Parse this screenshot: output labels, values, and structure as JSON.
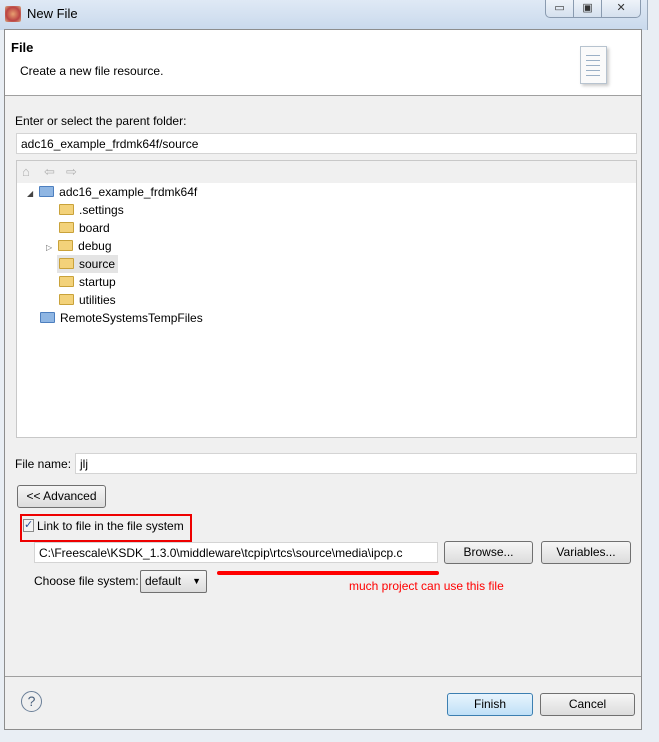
{
  "window": {
    "title": "New File",
    "controls": [
      "minimize",
      "maximize",
      "close"
    ]
  },
  "header": {
    "title": "File",
    "subtitle": "Create a new file resource.",
    "icon": "document-icon"
  },
  "parent_folder": {
    "label": "Enter or select the parent folder:",
    "value": "adc16_example_frdmk64f/source"
  },
  "tree": {
    "toolbar": [
      "home-icon",
      "back-icon",
      "forward-icon"
    ],
    "items": [
      {
        "label": "adc16_example_frdmk64f",
        "level": 0,
        "expanded": true,
        "type": "project"
      },
      {
        "label": ".settings",
        "level": 1,
        "type": "folder"
      },
      {
        "label": "board",
        "level": 1,
        "type": "folder"
      },
      {
        "label": "debug",
        "level": 1,
        "type": "folder",
        "collapsed": true
      },
      {
        "label": "source",
        "level": 1,
        "type": "folder",
        "selected": true
      },
      {
        "label": "startup",
        "level": 1,
        "type": "folder"
      },
      {
        "label": "utilities",
        "level": 1,
        "type": "folder"
      },
      {
        "label": "RemoteSystemsTempFiles",
        "level": 0,
        "type": "project"
      }
    ]
  },
  "file_name": {
    "label": "File name:",
    "value": "jlj"
  },
  "advanced_label": "<< Advanced",
  "link": {
    "label": "Link to file in the file system",
    "checked": true,
    "path": "C:\\Freescale\\KSDK_1.3.0\\middleware\\tcpip\\rtcs\\source\\media\\ipcp.c",
    "browse": "Browse...",
    "variables": "Variables..."
  },
  "filesystem": {
    "label": "Choose file system:",
    "value": "default"
  },
  "annotation": {
    "text": "much project can use this file",
    "color": "#ff0000"
  },
  "footer": {
    "finish": "Finish",
    "cancel": "Cancel"
  }
}
